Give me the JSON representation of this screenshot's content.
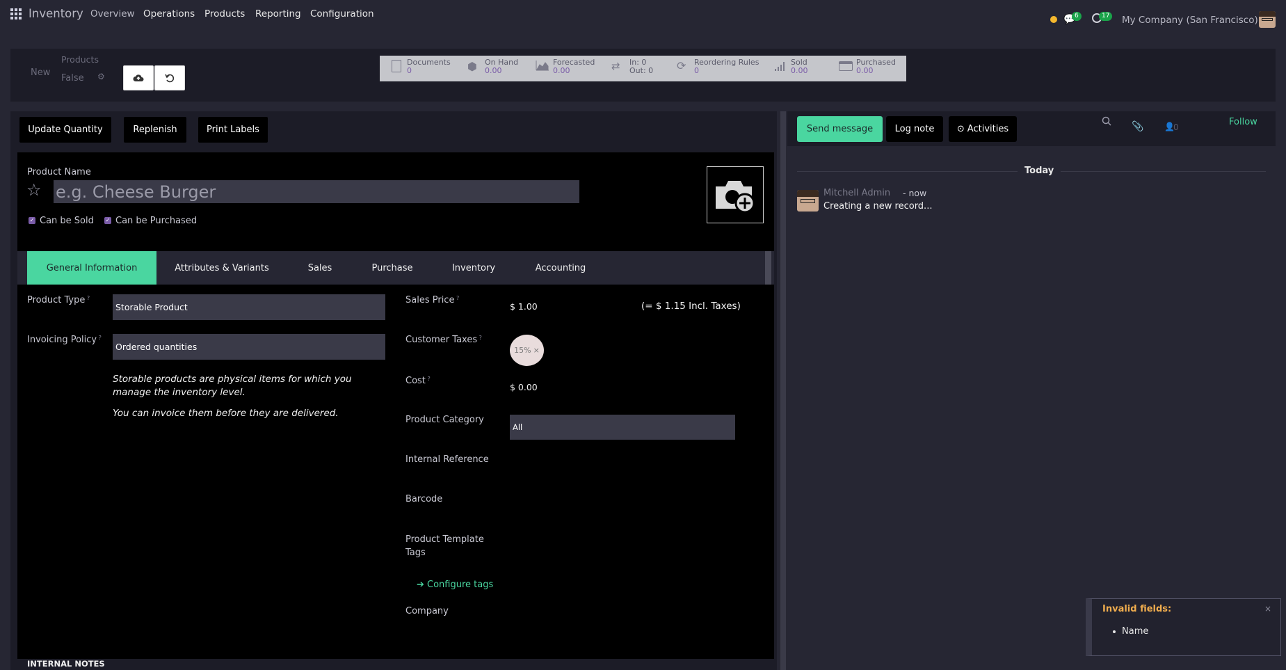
{
  "nav": {
    "app_title": "Inventory",
    "items": [
      "Overview",
      "Operations",
      "Products",
      "Reporting",
      "Configuration"
    ],
    "messages_count": "6",
    "activities_count": "17",
    "company": "My Company (San Francisco)"
  },
  "breadcrumb": {
    "new": "New",
    "parent": "Products",
    "record": "False"
  },
  "stats": [
    {
      "label": "Documents",
      "value": "0"
    },
    {
      "label": "On Hand",
      "value": "0.00"
    },
    {
      "label": "Forecasted",
      "value": "0.00"
    },
    {
      "label": "In: 0",
      "value": "Out: 0"
    },
    {
      "label": "Reordering Rules",
      "value": "0"
    },
    {
      "label": "Sold",
      "value": "0.00"
    },
    {
      "label": "Purchased",
      "value": "0.00"
    }
  ],
  "actions": {
    "update_quantity": "Update Quantity",
    "replenish": "Replenish",
    "print_labels": "Print Labels"
  },
  "product": {
    "name_label": "Product Name",
    "name_placeholder": "e.g. Cheese Burger",
    "can_be_sold": "Can be Sold",
    "can_be_purchased": "Can be Purchased"
  },
  "tabs": [
    "General Information",
    "Attributes & Variants",
    "Sales",
    "Purchase",
    "Inventory",
    "Accounting"
  ],
  "general": {
    "product_type_label": "Product Type",
    "product_type": "Storable Product",
    "invoicing_policy_label": "Invoicing Policy",
    "invoicing_policy": "Ordered quantities",
    "help1": "Storable products are physical items for which you manage the inventory level.",
    "help2": "You can invoice them before they are delivered.",
    "sales_price_label": "Sales Price",
    "sales_price": "$ 1.00",
    "incl_taxes": "(= $ 1.15 Incl. Taxes)",
    "customer_taxes_label": "Customer Taxes",
    "tax_tag": "15%",
    "cost_label": "Cost",
    "cost": "$ 0.00",
    "category_label": "Product Category",
    "category": "All",
    "internal_ref_label": "Internal Reference",
    "barcode_label": "Barcode",
    "template_tags_label": "Product Template Tags",
    "configure_tags": "Configure tags",
    "company_label": "Company",
    "internal_notes": "INTERNAL NOTES"
  },
  "chatter": {
    "send_message": "Send message",
    "log_note": "Log note",
    "activities": "Activities",
    "followers": "0",
    "follow": "Follow",
    "today": "Today",
    "author": "Mitchell Admin",
    "time": "- now",
    "message": "Creating a new record..."
  },
  "toast": {
    "title": "Invalid fields:",
    "item": "Name"
  },
  "colors": {
    "accent": "#4ad6a0",
    "warning": "#f0ad4e",
    "status_dot": "#f5b82e"
  }
}
